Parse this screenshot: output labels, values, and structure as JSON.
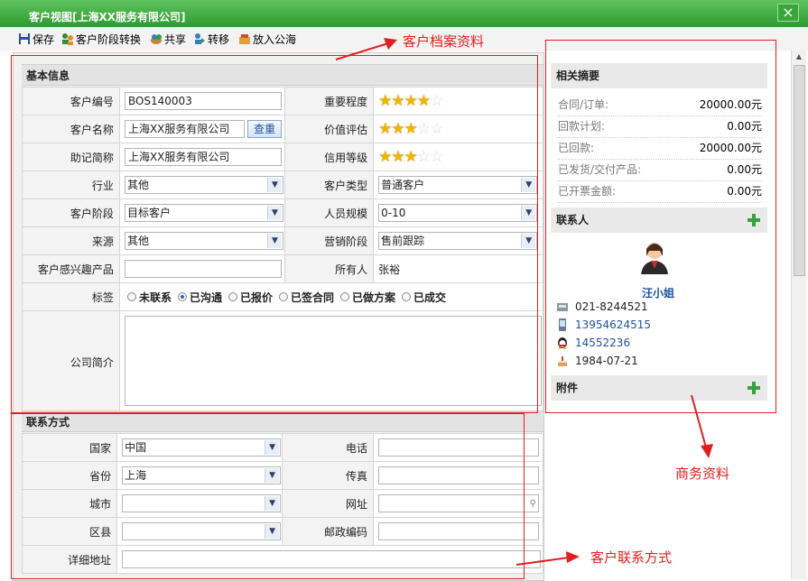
{
  "window": {
    "title": "客户视图[上海XX服务有限公司]"
  },
  "toolbar": {
    "save": "保存",
    "stage_switch": "客户阶段转换",
    "share": "共享",
    "transfer": "转移",
    "to_pool": "放入公海"
  },
  "basic": {
    "title": "基本信息",
    "labels": {
      "code": "客户编号",
      "importance": "重要程度",
      "name": "客户名称",
      "value_assess": "价值评估",
      "mnemonic": "助记简称",
      "credit": "信用等级",
      "industry": "行业",
      "type": "客户类型",
      "stage": "客户阶段",
      "scale": "人员规模",
      "source": "来源",
      "marketing": "营销阶段",
      "product": "客户感兴趣产品",
      "owner": "所有人",
      "tags": "标签",
      "intro": "公司简介"
    },
    "values": {
      "code": "BOS140003",
      "name": "上海XX服务有限公司",
      "check_button": "查重",
      "mnemonic": "上海XX服务有限公司",
      "industry": "其他",
      "type": "普通客户",
      "stage": "目标客户",
      "scale": "0-10",
      "source": "其他",
      "marketing": "售前跟踪",
      "product": "",
      "owner": "张裕"
    },
    "ratings": {
      "importance": 4,
      "value_assess": 3,
      "credit": 3,
      "max": 5
    },
    "tag_options": [
      "未联系",
      "已沟通",
      "已报价",
      "已签合同",
      "已做方案",
      "已成交"
    ],
    "tag_selected": "已沟通"
  },
  "contact": {
    "title": "联系方式",
    "labels": {
      "country": "国家",
      "phone": "电话",
      "province": "省份",
      "fax": "传真",
      "city": "城市",
      "website": "网址",
      "district": "区县",
      "postcode": "邮政编码",
      "address": "详细地址"
    },
    "values": {
      "country": "中国",
      "province": "上海",
      "city": "",
      "district": "",
      "phone": "",
      "fax": "",
      "website": "",
      "postcode": "",
      "address": ""
    }
  },
  "summary": {
    "title": "相关摘要",
    "rows": [
      {
        "label": "合同/订单:",
        "value": "20000.00元"
      },
      {
        "label": "回款计划:",
        "value": "0.00元"
      },
      {
        "label": "已回款:",
        "value": "20000.00元"
      },
      {
        "label": "已发货/交付产品:",
        "value": "0.00元"
      },
      {
        "label": "已开票金额:",
        "value": "0.00元"
      }
    ]
  },
  "contacts": {
    "title": "联系人",
    "person": {
      "name": "汪小姐",
      "phone": "021-8244521",
      "mobile": "13954624515",
      "qq": "14552236",
      "birthday": "1984-07-21"
    }
  },
  "attachments": {
    "title": "附件"
  },
  "annotations": {
    "profile": "客户档案资料",
    "business": "商务资料",
    "contact_info": "客户联系方式"
  },
  "colors": {
    "accent_green": "#2e9a2e",
    "star": "#f1b400",
    "annotation_red": "#e02020",
    "link_blue": "#2050a0"
  }
}
